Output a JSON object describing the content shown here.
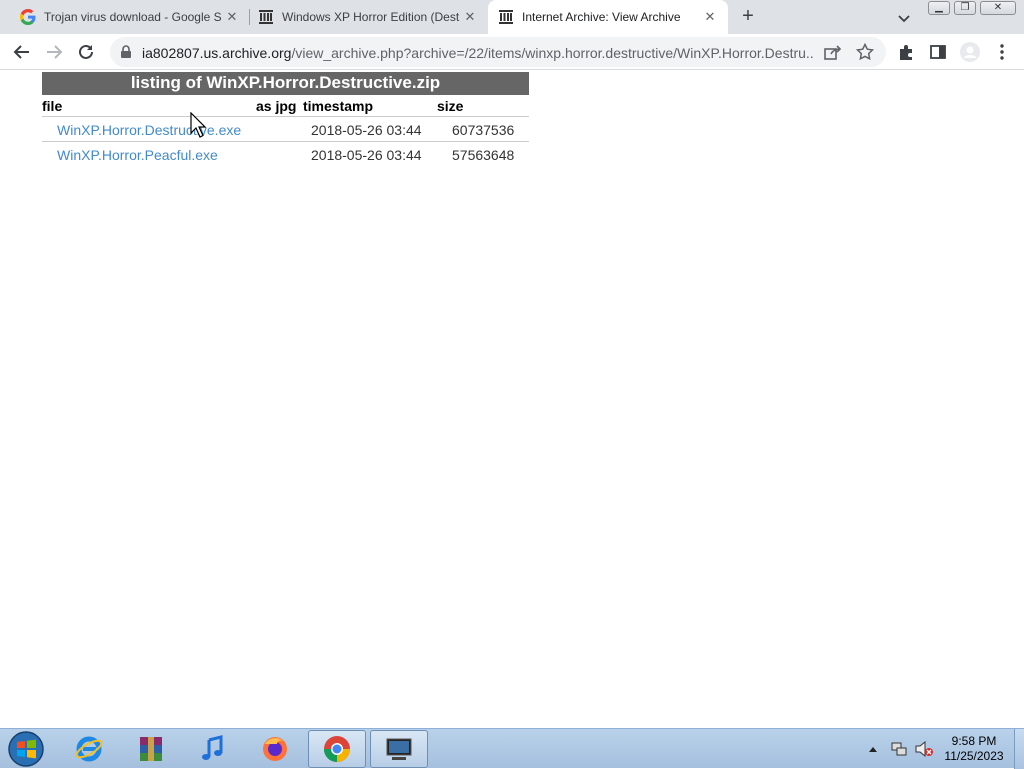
{
  "browser": {
    "tabs": [
      {
        "title": "Trojan virus download - Google S",
        "favicon": "google-g-icon",
        "active": false
      },
      {
        "title": "Windows XP Horror Edition (Dest",
        "favicon": "archive-icon",
        "active": false
      },
      {
        "title": "Internet Archive: View Archive",
        "favicon": "archive-icon",
        "active": true
      }
    ],
    "url_host": "ia802807.us.archive.org",
    "url_path": "/view_archive.php?archive=/22/items/winxp.horror.destructive/WinXP.Horror.Destru..."
  },
  "page": {
    "title": "listing of WinXP.Horror.Destructive.zip",
    "columns": {
      "file": "file",
      "as_jpg": "as jpg",
      "timestamp": "timestamp",
      "size": "size"
    },
    "files": [
      {
        "name": "WinXP.Horror.Destructive.exe",
        "timestamp": "2018-05-26 03:44",
        "size": "60737536"
      },
      {
        "name": "WinXP.Horror.Peacful.exe",
        "timestamp": "2018-05-26 03:44",
        "size": "57563648"
      }
    ]
  },
  "taskbar": {
    "pinned": [
      "internet-explorer-icon",
      "winrar-icon",
      "itunes-icon",
      "firefox-icon",
      "chrome-icon",
      "monitor-app-icon"
    ],
    "clock_time": "9:58 PM",
    "clock_date": "11/25/2023"
  },
  "colors": {
    "link": "#428bca",
    "title_bar": "#666666",
    "tabstrip": "#dee1e6"
  }
}
